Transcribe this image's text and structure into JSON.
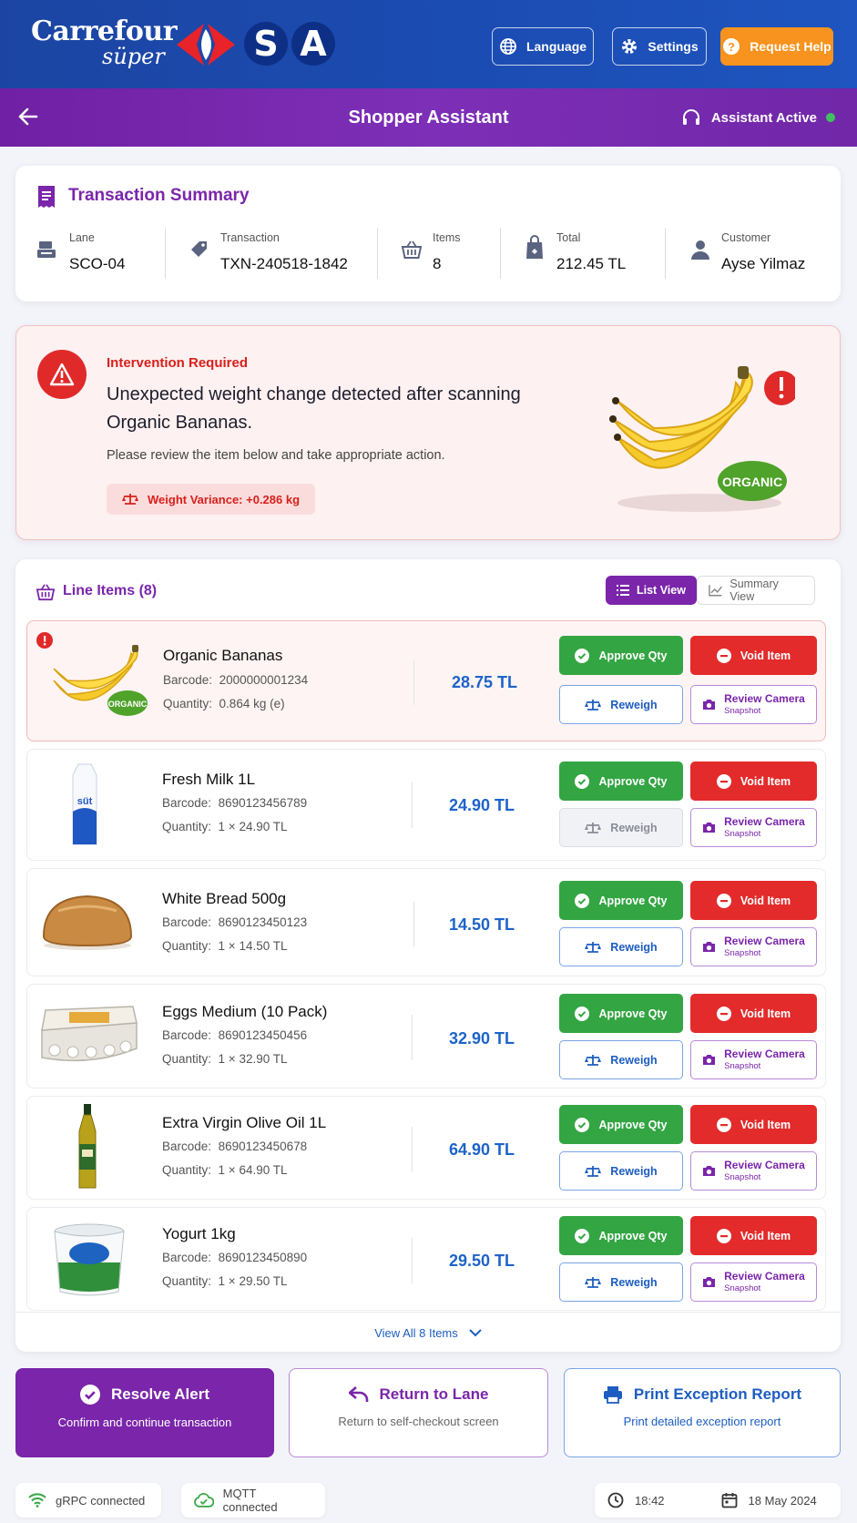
{
  "header": {
    "brand_name": "Carrefour",
    "brand_sub": "süper",
    "brand_mark": "SA",
    "language_label": "Language",
    "settings_label": "Settings",
    "help_label": "Request Help"
  },
  "subheader": {
    "title": "Shopper Assistant",
    "assistant_status": "Assistant Active"
  },
  "summary": {
    "title": "Transaction Summary",
    "fields": [
      {
        "label": "Lane",
        "value": "SCO-04",
        "icon": "pos-icon"
      },
      {
        "label": "Transaction",
        "value": "TXN-240518-1842",
        "icon": "tag-icon"
      },
      {
        "label": "Items",
        "value": "8",
        "icon": "basket-icon"
      },
      {
        "label": "Total",
        "value": "212.45 TL",
        "icon": "bag-icon"
      },
      {
        "label": "Customer",
        "value": "Ayse Yilmaz",
        "icon": "user-icon"
      }
    ]
  },
  "alert": {
    "heading": "Intervention Required",
    "message": "Unexpected weight change detected after scanning Organic Bananas.",
    "sub": "Please review the item below and take appropriate action.",
    "variance": "Weight Variance: +0.286 kg",
    "product_badge": "ORGANIC"
  },
  "line_items": {
    "title": "Line Items (8)",
    "list_view_label": "List View",
    "summary_view_label": "Summary View",
    "barcode_label": "Barcode:",
    "quantity_label": "Quantity:",
    "approve_label": "Approve Qty",
    "void_label": "Void Item",
    "reweigh_label": "Reweigh",
    "review_label": "Review Camera",
    "review_sub": "Snapshot",
    "items": [
      {
        "name": "Organic Bananas",
        "barcode": "2000000001234",
        "quantity": "0.864 kg (e)",
        "price": "28.75 TL",
        "thumb_badge": "ORGANIC"
      },
      {
        "name": "Fresh Milk 1L",
        "barcode": "8690123456789",
        "quantity": "1 × 24.90 TL",
        "price": "24.90 TL",
        "thumb_badge": "süt"
      },
      {
        "name": "White Bread 500g",
        "barcode": "8690123450123",
        "quantity": "1 × 14.50 TL",
        "price": "14.50 TL"
      },
      {
        "name": "Eggs Medium (10 Pack)",
        "barcode": "8690123450456",
        "quantity": "1 × 32.90 TL",
        "price": "32.90 TL"
      },
      {
        "name": "Extra Virgin Olive Oil 1L",
        "barcode": "8690123450678",
        "quantity": "1 × 64.90 TL",
        "price": "64.90 TL"
      },
      {
        "name": "Yogurt 1kg",
        "barcode": "8690123450890",
        "quantity": "1 × 29.50 TL",
        "price": "29.50 TL"
      }
    ],
    "view_all_label": "View All 8 Items"
  },
  "actions": {
    "resolve": {
      "title": "Resolve Alert",
      "sub": "Confirm and continue transaction"
    },
    "return": {
      "title": "Return to Lane",
      "sub": "Return to self-checkout screen"
    },
    "print": {
      "title": "Print Exception Report",
      "sub": "Print detailed exception report"
    }
  },
  "statusbar": {
    "grpc": "gRPC connected",
    "mqtt": "MQTT connected",
    "time": "18:42",
    "date": "18 May 2024"
  },
  "colors": {
    "brand_blue": "#1c45a3",
    "brand_purple": "#7a25aa",
    "help_orange": "#f7931e",
    "approve_green": "#34a543",
    "void_red": "#e32b2b",
    "price_blue": "#1d63c9"
  }
}
